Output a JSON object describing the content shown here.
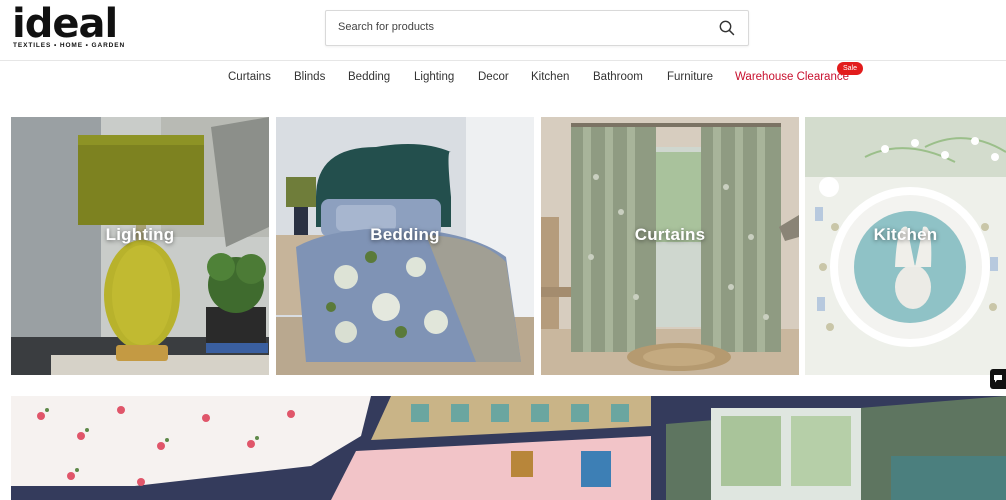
{
  "brand": {
    "name": "ideal",
    "tagline": "TEXTILES  •  HOME  •  GARDEN"
  },
  "search": {
    "placeholder": "Search for products",
    "value": ""
  },
  "nav": {
    "items": [
      {
        "label": "Curtains"
      },
      {
        "label": "Blinds"
      },
      {
        "label": "Bedding"
      },
      {
        "label": "Lighting"
      },
      {
        "label": "Decor"
      },
      {
        "label": "Kitchen"
      },
      {
        "label": "Bathroom"
      },
      {
        "label": "Furniture"
      },
      {
        "label": "Warehouse Clearance",
        "badge": "Sale"
      }
    ]
  },
  "categories": [
    {
      "label": "Lighting"
    },
    {
      "label": "Bedding"
    },
    {
      "label": "Curtains"
    },
    {
      "label": "Kitchen"
    }
  ],
  "colors": {
    "accent": "#c8102e",
    "badge": "#e21c1c",
    "banner_navy": "#343b5c"
  },
  "icons": {
    "search": "search-icon",
    "chat": "chat-icon"
  }
}
